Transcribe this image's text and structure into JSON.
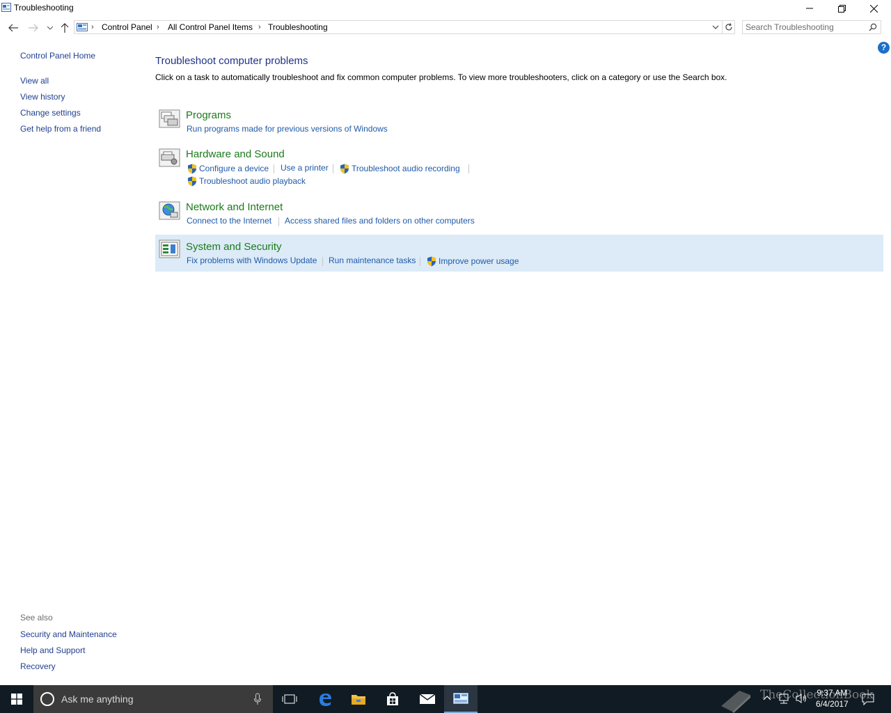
{
  "window": {
    "title": "Troubleshooting"
  },
  "address_bar": {
    "crumbs": [
      "Control Panel",
      "All Control Panel Items",
      "Troubleshooting"
    ]
  },
  "search": {
    "placeholder": "Search Troubleshooting"
  },
  "sidebar": {
    "home": "Control Panel Home",
    "items": [
      {
        "label": "View all"
      },
      {
        "label": "View history"
      },
      {
        "label": "Change settings"
      },
      {
        "label": "Get help from a friend"
      }
    ],
    "see_also_heading": "See also",
    "see_also": [
      {
        "label": "Security and Maintenance"
      },
      {
        "label": "Help and Support"
      },
      {
        "label": "Recovery"
      }
    ]
  },
  "main": {
    "title": "Troubleshoot computer problems",
    "description": "Click on a task to automatically troubleshoot and fix common computer problems. To view more troubleshooters, click on a category or use the Search box.",
    "categories": [
      {
        "title": "Programs",
        "tasks": [
          "Run programs made for previous versions of Windows"
        ]
      },
      {
        "title": "Hardware and Sound",
        "tasks": [
          "Configure a device",
          "Use a printer",
          "Troubleshoot audio recording",
          "Troubleshoot audio playback"
        ]
      },
      {
        "title": "Network and Internet",
        "tasks": [
          "Connect to the Internet",
          "Access shared files and folders on other computers"
        ]
      },
      {
        "title": "System and Security",
        "tasks": [
          "Fix problems with Windows Update",
          "Run maintenance tasks",
          "Improve power usage"
        ]
      }
    ]
  },
  "taskbar": {
    "search_placeholder": "Ask me anything",
    "time": "9:37 AM",
    "date": "6/4/2017",
    "watermark": "TheCollectionBook"
  },
  "icons": [
    "app-icon",
    "back-icon",
    "forward-icon",
    "recent-icon",
    "up-icon",
    "refresh-icon",
    "search-icon",
    "help-icon",
    "shield-icon",
    "windows-logo-icon",
    "microphone-icon",
    "task-view-icon",
    "edge-icon",
    "file-explorer-icon",
    "store-icon",
    "mail-icon",
    "control-panel-icon"
  ],
  "colors": {
    "link": "#1f5aa8",
    "category_title": "#1b7a1b",
    "heading": "#1e3287",
    "highlight": "#dcebf7",
    "taskbar": "#111b23"
  }
}
